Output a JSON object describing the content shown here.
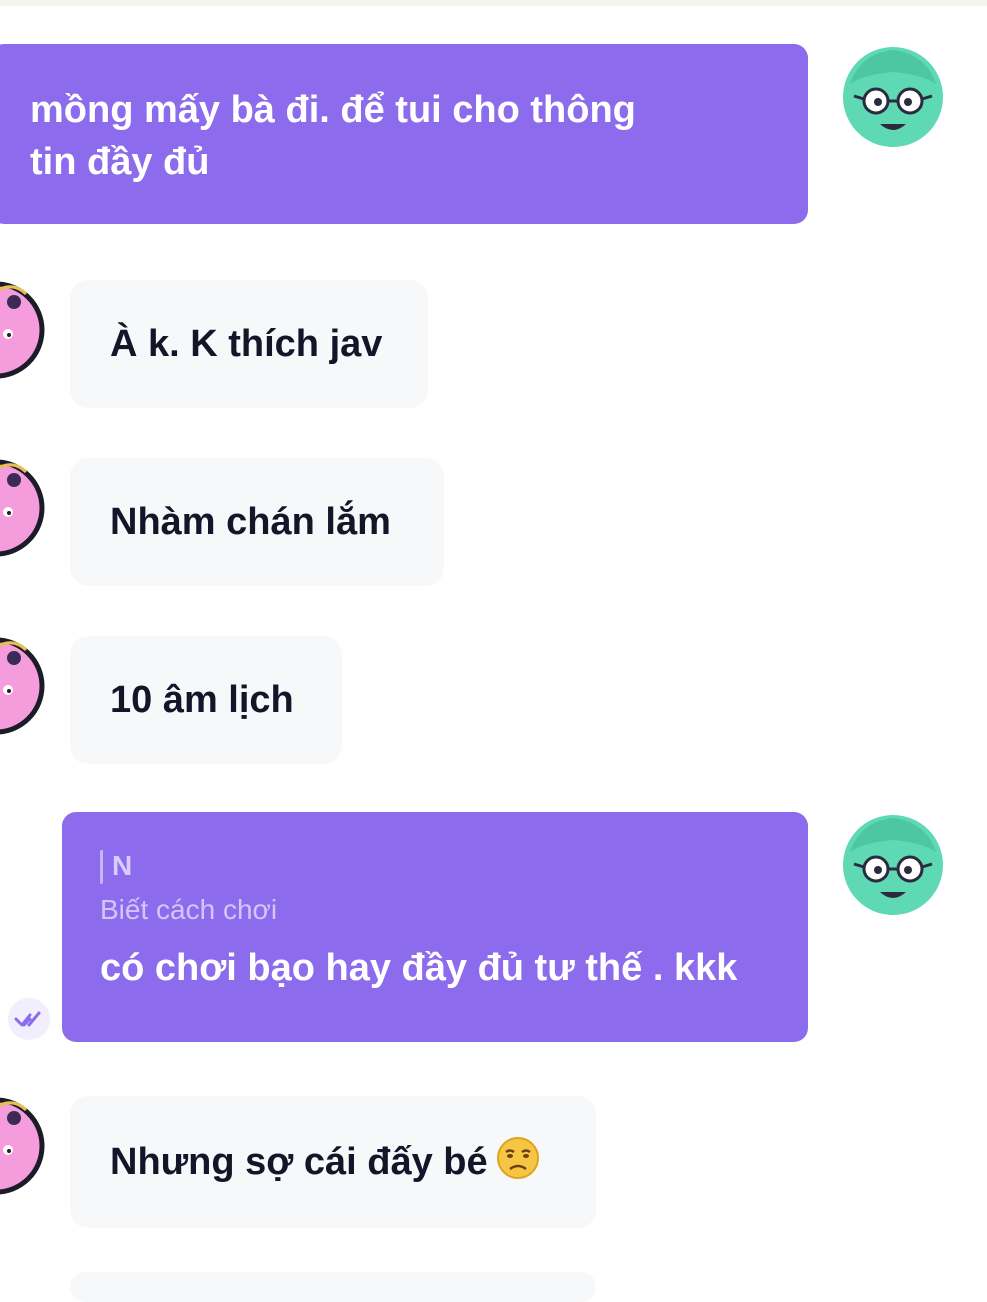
{
  "messages": [
    {
      "direction": "outgoing",
      "text": "mồng mấy bà đi. để tui cho thông tin đầy đủ"
    },
    {
      "direction": "incoming",
      "text": "À k. K thích jav"
    },
    {
      "direction": "incoming",
      "text": "Nhàm chán lắm"
    },
    {
      "direction": "incoming",
      "text": "10 âm lịch"
    },
    {
      "direction": "outgoing",
      "reply": {
        "name": "N",
        "text": "Biết cách chơi"
      },
      "text": "có chơi bạo hay  đầy đủ tư thế . kkk",
      "status_icon": "seen-checkmark-icon"
    },
    {
      "direction": "incoming",
      "text": "Nhưng sợ cái đấy bé",
      "emoji": "unamused-face-emoji"
    }
  ],
  "colors": {
    "outgoing_bubble": "#8c6cec",
    "incoming_bubble": "#f7f8fa",
    "outgoing_text": "#ffffff",
    "incoming_text": "#15152a",
    "my_avatar": "#5fd9b4",
    "their_avatar": "#f59cdc"
  }
}
